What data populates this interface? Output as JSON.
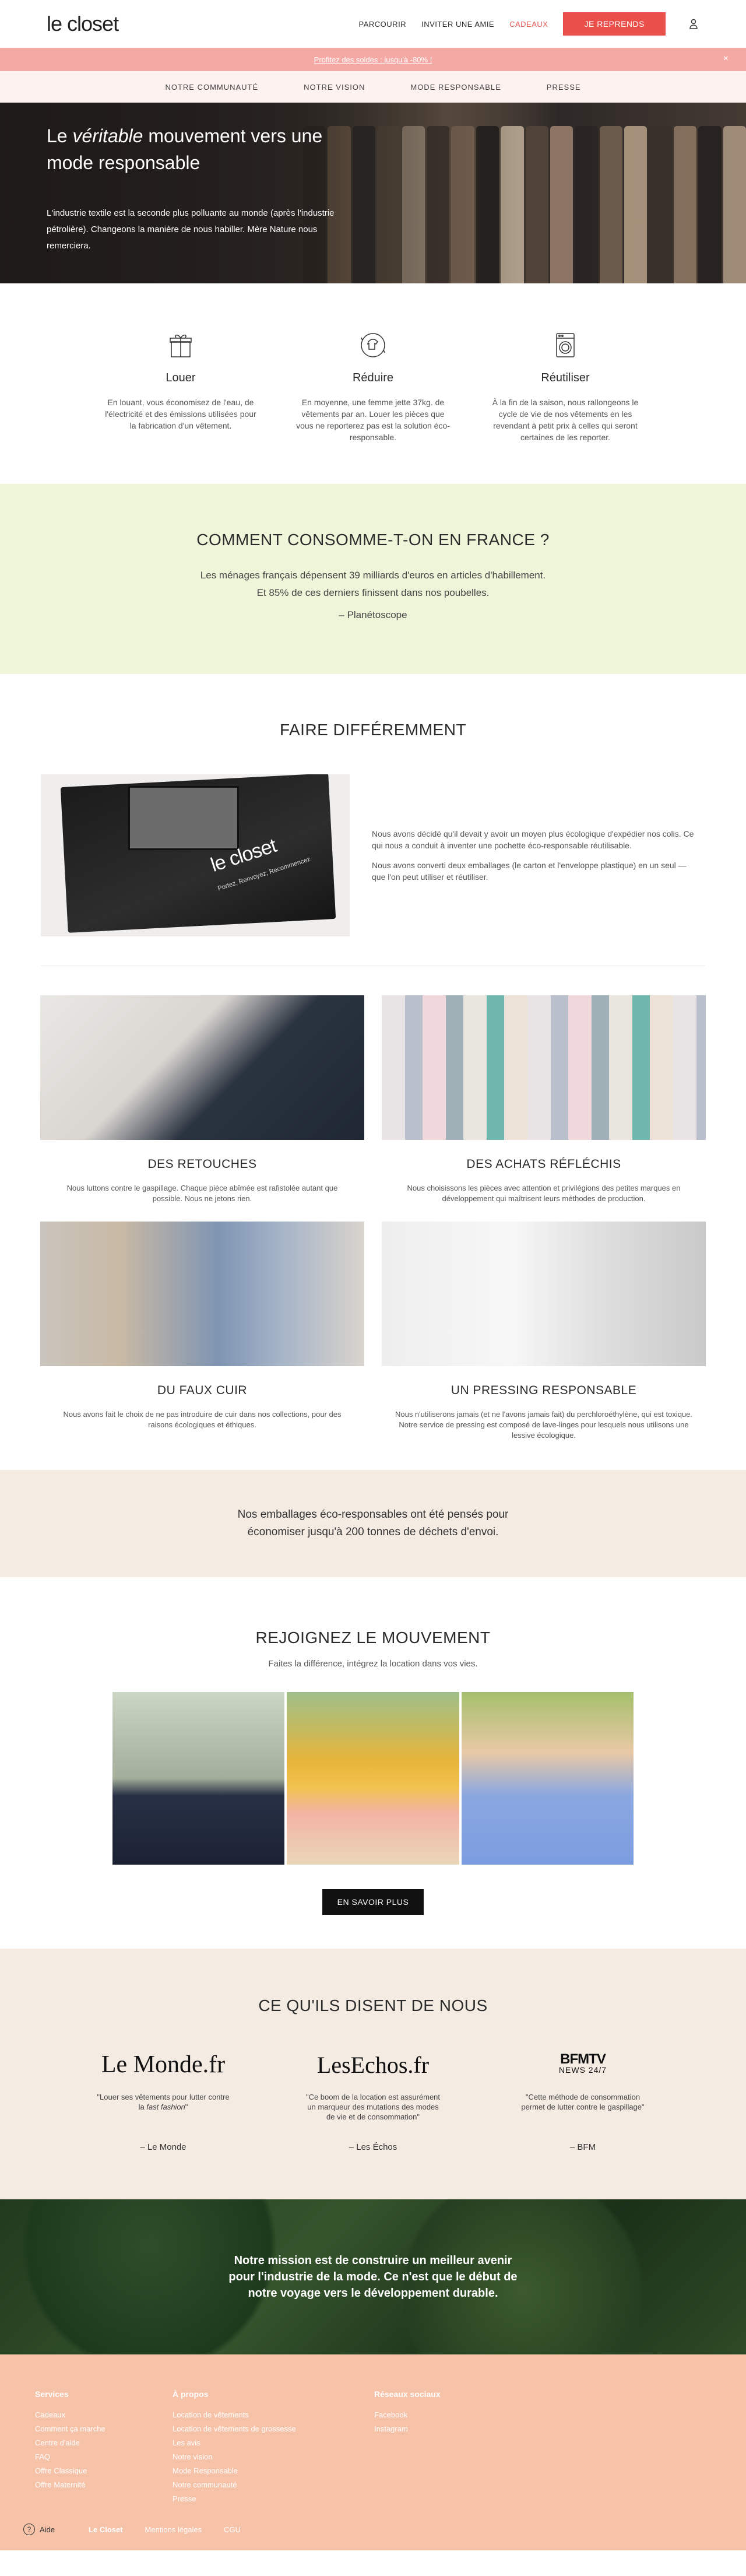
{
  "header": {
    "logo": "le closet",
    "nav": [
      "PARCOURIR",
      "INVITER UNE AMIE",
      "CADEAUX"
    ],
    "cta": "JE REPRENDS",
    "user_icon": "user-icon"
  },
  "promo": {
    "text": "Profitez des soldes : jusqu'à -80% !",
    "close": "×"
  },
  "subnav": [
    "NOTRE COMMUNAUTÉ",
    "NOTRE VISION",
    "MODE RESPONSABLE",
    "PRESSE"
  ],
  "hero": {
    "title_pre": "Le ",
    "title_em": "véritable",
    "title_post": " mouvement vers une mode responsable",
    "text": "L'industrie textile est la seconde plus polluante au monde (après l'industrie pétrolière). Changeons la manière de nous habiller. Mère Nature nous remerciera."
  },
  "features": [
    {
      "icon": "gift-box-icon",
      "title": "Louer",
      "text": "En louant, vous économisez de l'eau, de l'électricité et des émissions utilisées pour la fabrication d'un vêtement."
    },
    {
      "icon": "recycle-shirt-icon",
      "title": "Réduire",
      "text": "En moyenne, une femme jette 37kg. de vêtements par an. Louer les pièces que vous ne reporterez pas est la solution éco-responsable."
    },
    {
      "icon": "washing-machine-icon",
      "title": "Réutiliser",
      "text": "À la fin de la saison, nous rallongeons le cycle de vie de nos vêtements en les revendant à petit prix à celles qui seront certaines de les reporter."
    }
  ],
  "consume": {
    "title": "COMMENT CONSOMME-T-ON EN FRANCE ?",
    "line1": "Les ménages français dépensent 39 milliards d'euros en articles d'habillement.",
    "line2": "Et 85% de ces derniers finissent dans nos poubelles.",
    "source": "– Planétoscope"
  },
  "diff": {
    "title": "FAIRE DIFFÉREMMENT",
    "bag_brand": "le closet",
    "bag_tag": "Portez, Renvoyez, Recommencez",
    "p1": "Nous avons décidé qu'il devait y avoir un moyen plus écologique d'expédier nos colis. Ce qui nous a conduit à inventer une pochette éco-responsable réutilisable.",
    "p2": "Nous avons converti deux emballages (le carton et l'enveloppe plastique) en un seul — que l'on peut utiliser et réutiliser."
  },
  "cards": [
    {
      "title": "DES RETOUCHES",
      "text": "Nous luttons contre le gaspillage. Chaque pièce abîmée est rafistolée autant que possible. Nous ne jetons rien."
    },
    {
      "title": "DES ACHATS RÉFLÉCHIS",
      "text": "Nous choisissons les pièces avec attention et privilégions des petites marques en développement qui maîtrisent leurs méthodes de production."
    },
    {
      "title": "DU FAUX CUIR",
      "text": "Nous avons fait le choix de ne pas introduire de cuir dans nos collections, pour des raisons écologiques et éthiques."
    },
    {
      "title": "UN PRESSING RESPONSABLE",
      "text": "Nous n'utiliserons jamais (et ne l'avons jamais fait) du perchloroéthylène, qui est toxique. Notre service de pressing est composé de lave-linges pour lesquels nous utilisons une lessive écologique."
    }
  ],
  "eco": {
    "line1": "Nos emballages éco-responsables ont été pensés pour",
    "line2": "économiser jusqu'à 200 tonnes de déchets d'envoi."
  },
  "join": {
    "title": "REJOIGNEZ LE MOUVEMENT",
    "sub": "Faites la différence, intégrez la location dans vos vies.",
    "button": "EN SAVOIR PLUS"
  },
  "press": {
    "title": "CE QU'ILS DISENT DE NOUS",
    "items": [
      {
        "logo": "Le Monde.fr",
        "quote_pre": "\"Louer ses vêtements pour lutter contre la ",
        "quote_em": "fast fashion",
        "quote_post": "\"",
        "source": "– Le Monde"
      },
      {
        "logo": "LesEchos.fr",
        "quote": "\"Ce boom de la location est assurément un marqueur des mutations des modes de vie et de consommation\"",
        "source": "– Les Échos"
      },
      {
        "logo_main": "BFMTV",
        "logo_sub": "NEWS 24/7",
        "quote": "\"Cette méthode de consommation permet de lutter contre le gaspillage\"",
        "source": "– BFM"
      }
    ]
  },
  "mission": {
    "text": "Notre mission est de construire un meilleur avenir pour l'industrie de la mode. Ce n'est que le début de notre voyage vers le développement durable."
  },
  "footer": {
    "col1": {
      "title": "Services",
      "items": [
        "Cadeaux",
        "Comment ça marche",
        "Centre d'aide",
        "FAQ",
        "Offre Classique",
        "Offre Maternité"
      ]
    },
    "col2": {
      "title": "À propos",
      "items": [
        "Location de vêtements",
        "Location de vêtements de grossesse",
        "Les avis",
        "Notre vision",
        "Mode Responsable",
        "Notre communauté",
        "Presse"
      ]
    },
    "col3": {
      "title": "Réseaux sociaux",
      "items": [
        "Facebook",
        "Instagram"
      ]
    },
    "help": "Aide",
    "brand": "Le Closet",
    "legal": "Mentions légales",
    "cgu": "CGU"
  }
}
